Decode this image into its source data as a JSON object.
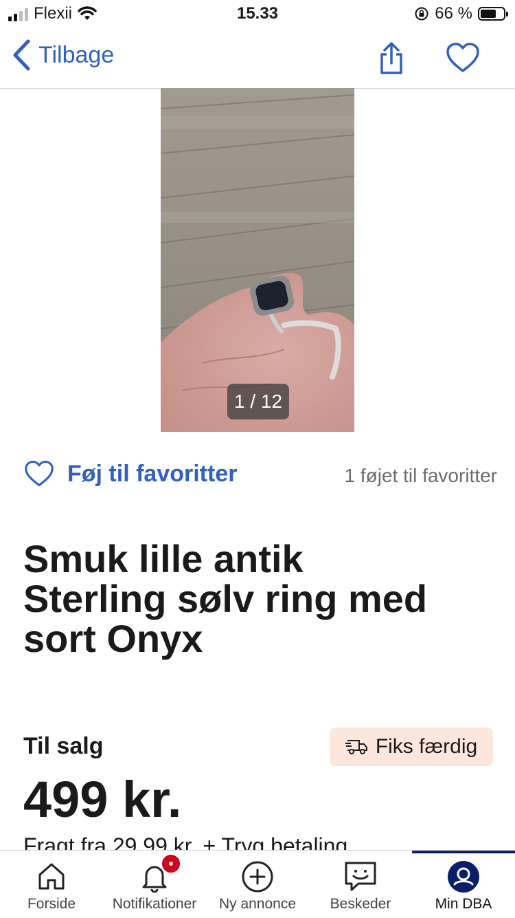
{
  "status_bar": {
    "carrier": "Flexii",
    "time": "15.33",
    "battery_percent": "66 %"
  },
  "nav": {
    "back_label": "Tilbage"
  },
  "gallery": {
    "counter": "1 / 12"
  },
  "favorites": {
    "add_label": "Føj til favoritter",
    "count_text": "1 føjet til favoritter"
  },
  "listing": {
    "title_lines": [
      "Smuk lille antik",
      "Sterling sølv ring med",
      "sort Onyx"
    ],
    "sale_label": "Til salg",
    "delivery_badge": "Fiks færdig",
    "price": "499 kr.",
    "freight": "Fragt fra 29,99 kr. + Tryg betaling"
  },
  "tabs": [
    {
      "label": "Forside",
      "icon": "home-icon"
    },
    {
      "label": "Notifikationer",
      "icon": "bell-icon"
    },
    {
      "label": "Ny annonce",
      "icon": "plus-circle-icon"
    },
    {
      "label": "Beskeder",
      "icon": "chat-icon"
    },
    {
      "label": "Min DBA",
      "icon": "profile-icon"
    }
  ],
  "colors": {
    "accent": "#3061c0",
    "badge": "#d0021b",
    "delivery_bg": "#fde7dd",
    "active_tab": "#0b1e6b"
  }
}
